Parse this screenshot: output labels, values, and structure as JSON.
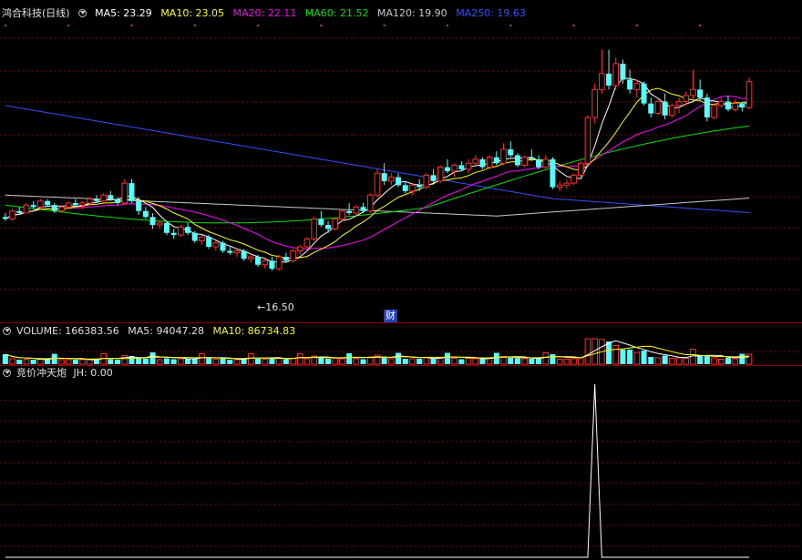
{
  "stock": {
    "name": "鸿合科技(日线)"
  },
  "ma_legend": [
    {
      "label": "MA5: 23.29",
      "color": "#ffffff"
    },
    {
      "label": "MA10: 23.05",
      "color": "#ffff00"
    },
    {
      "label": "MA20: 22.11",
      "color": "#ff00ff"
    },
    {
      "label": "MA60: 21.52",
      "color": "#00e000"
    },
    {
      "label": "MA120: 19.90",
      "color": "#c8c8c8"
    },
    {
      "label": "MA250: 19.63",
      "color": "#3050ff"
    }
  ],
  "price_panel": {
    "low_marker": "16.50",
    "finance_badge": "财"
  },
  "volume_panel": {
    "title": "VOLUME: 166383.56",
    "ma5": "MA5: 94047.28",
    "ma10": "MA10: 86734.83"
  },
  "indicator_panel": {
    "title": "竞价冲天炮",
    "jh": "JH: 0.00"
  },
  "colors": {
    "up": "#ff3030",
    "down": "#54ffff",
    "grid": "#8b0000",
    "text": "#c0c0c0"
  },
  "chart_data": {
    "type": "candlestick",
    "candles": [
      [
        21.2,
        21.4,
        21.0,
        21.1
      ],
      [
        21.1,
        21.6,
        21.0,
        21.5
      ],
      [
        21.5,
        21.7,
        21.3,
        21.4
      ],
      [
        21.4,
        21.9,
        21.4,
        21.8
      ],
      [
        21.8,
        22.0,
        21.6,
        21.7
      ],
      [
        21.7,
        22.1,
        21.6,
        22.0
      ],
      [
        22.0,
        22.1,
        21.7,
        21.8
      ],
      [
        21.8,
        21.9,
        21.4,
        21.5
      ],
      [
        21.5,
        21.8,
        21.4,
        21.7
      ],
      [
        21.7,
        22.0,
        21.6,
        21.9
      ],
      [
        21.9,
        22.1,
        21.7,
        21.8
      ],
      [
        21.8,
        22.0,
        21.6,
        21.9
      ],
      [
        21.9,
        22.2,
        21.8,
        22.1
      ],
      [
        22.1,
        22.3,
        21.9,
        22.0
      ],
      [
        22.0,
        22.4,
        21.9,
        22.3
      ],
      [
        22.3,
        22.5,
        22.0,
        22.1
      ],
      [
        22.1,
        22.2,
        21.8,
        21.9
      ],
      [
        21.9,
        23.1,
        21.8,
        22.9
      ],
      [
        22.9,
        23.1,
        21.9,
        22.0
      ],
      [
        22.0,
        22.2,
        21.3,
        21.5
      ],
      [
        21.5,
        21.7,
        21.1,
        21.2
      ],
      [
        21.2,
        21.4,
        20.6,
        20.8
      ],
      [
        20.8,
        21.0,
        20.6,
        20.9
      ],
      [
        20.9,
        21.0,
        20.3,
        20.4
      ],
      [
        20.4,
        20.6,
        20.1,
        20.3
      ],
      [
        20.3,
        20.8,
        20.2,
        20.7
      ],
      [
        20.7,
        20.9,
        20.3,
        20.4
      ],
      [
        20.4,
        20.5,
        19.9,
        20.0
      ],
      [
        20.0,
        20.3,
        19.8,
        20.2
      ],
      [
        20.2,
        20.3,
        19.6,
        19.7
      ],
      [
        19.7,
        20.0,
        19.5,
        19.9
      ],
      [
        19.9,
        20.0,
        19.4,
        19.5
      ],
      [
        19.5,
        19.7,
        19.3,
        19.4
      ],
      [
        19.4,
        19.6,
        19.2,
        19.5
      ],
      [
        19.5,
        19.6,
        19.0,
        19.1
      ],
      [
        19.1,
        19.4,
        18.9,
        19.2
      ],
      [
        19.2,
        19.3,
        18.7,
        18.8
      ],
      [
        18.8,
        19.1,
        18.6,
        19.0
      ],
      [
        19.0,
        19.2,
        18.5,
        18.6
      ],
      [
        18.6,
        19.3,
        18.5,
        19.2
      ],
      [
        19.2,
        19.4,
        18.9,
        19.0
      ],
      [
        19.0,
        19.6,
        18.9,
        19.5
      ],
      [
        19.5,
        19.8,
        19.3,
        19.7
      ],
      [
        19.7,
        20.2,
        19.6,
        20.1
      ],
      [
        20.1,
        21.2,
        20.0,
        21.1
      ],
      [
        21.1,
        21.5,
        20.7,
        20.8
      ],
      [
        20.8,
        21.0,
        20.4,
        20.6
      ],
      [
        20.6,
        21.2,
        20.5,
        21.1
      ],
      [
        21.1,
        21.6,
        21.0,
        21.5
      ],
      [
        21.5,
        21.9,
        21.3,
        21.4
      ],
      [
        21.4,
        21.8,
        21.2,
        21.7
      ],
      [
        21.7,
        21.9,
        21.4,
        21.5
      ],
      [
        21.5,
        22.4,
        21.4,
        22.3
      ],
      [
        22.3,
        23.6,
        22.2,
        23.4
      ],
      [
        23.4,
        23.9,
        22.8,
        23.0
      ],
      [
        23.0,
        23.4,
        22.8,
        23.2
      ],
      [
        23.2,
        23.4,
        22.7,
        22.8
      ],
      [
        22.8,
        23.0,
        22.4,
        22.5
      ],
      [
        22.5,
        22.9,
        22.3,
        22.8
      ],
      [
        22.8,
        23.1,
        22.5,
        22.7
      ],
      [
        22.7,
        23.4,
        22.6,
        23.3
      ],
      [
        23.3,
        23.6,
        22.9,
        23.0
      ],
      [
        23.0,
        23.8,
        22.9,
        23.7
      ],
      [
        23.7,
        24.1,
        23.4,
        23.5
      ],
      [
        23.5,
        23.9,
        23.2,
        23.8
      ],
      [
        23.8,
        24.0,
        23.5,
        23.6
      ],
      [
        23.6,
        24.1,
        23.4,
        23.9
      ],
      [
        23.9,
        24.3,
        23.7,
        24.1
      ],
      [
        24.1,
        24.2,
        23.6,
        23.7
      ],
      [
        23.7,
        24.3,
        23.6,
        24.2
      ],
      [
        24.2,
        24.5,
        23.8,
        23.9
      ],
      [
        23.9,
        24.9,
        23.8,
        24.6
      ],
      [
        24.6,
        25.0,
        24.2,
        24.3
      ],
      [
        24.3,
        24.4,
        23.7,
        23.8
      ],
      [
        23.8,
        24.3,
        23.7,
        24.2
      ],
      [
        24.2,
        24.6,
        24.0,
        24.1
      ],
      [
        24.1,
        24.3,
        23.6,
        23.7
      ],
      [
        23.7,
        24.3,
        23.6,
        24.1
      ],
      [
        24.1,
        24.2,
        22.6,
        22.7
      ],
      [
        22.7,
        23.0,
        22.5,
        22.8
      ],
      [
        22.8,
        23.1,
        22.6,
        22.9
      ],
      [
        22.9,
        23.4,
        22.8,
        23.3
      ],
      [
        23.3,
        24.0,
        23.2,
        23.9
      ],
      [
        23.9,
        26.3,
        23.8,
        26.2
      ],
      [
        26.2,
        27.9,
        25.9,
        27.6
      ],
      [
        27.6,
        29.6,
        27.4,
        28.4
      ],
      [
        28.4,
        29.6,
        27.6,
        27.8
      ],
      [
        27.8,
        29.2,
        27.6,
        28.9
      ],
      [
        28.9,
        29.1,
        27.9,
        28.1
      ],
      [
        28.1,
        28.6,
        27.4,
        27.6
      ],
      [
        27.6,
        28.1,
        27.2,
        27.9
      ],
      [
        27.9,
        28.0,
        26.8,
        26.9
      ],
      [
        26.9,
        27.2,
        26.2,
        26.4
      ],
      [
        26.4,
        27.1,
        26.3,
        27.0
      ],
      [
        27.0,
        27.4,
        26.1,
        26.3
      ],
      [
        26.3,
        26.9,
        26.2,
        26.8
      ],
      [
        26.8,
        27.2,
        26.4,
        27.0
      ],
      [
        27.0,
        27.5,
        26.8,
        27.3
      ],
      [
        27.3,
        28.6,
        27.1,
        27.6
      ],
      [
        27.6,
        28.1,
        27.0,
        27.2
      ],
      [
        27.2,
        27.4,
        26.0,
        26.2
      ],
      [
        26.2,
        26.9,
        26.1,
        26.8
      ],
      [
        26.8,
        27.2,
        26.7,
        27.0
      ],
      [
        27.0,
        27.3,
        26.5,
        26.6
      ],
      [
        26.6,
        27.1,
        26.5,
        26.9
      ],
      [
        26.9,
        27.0,
        26.5,
        26.7
      ],
      [
        26.7,
        28.2,
        26.6,
        28.0
      ]
    ],
    "price_range": [
      16.0,
      31.0
    ],
    "jh_spike_index": 84
  }
}
